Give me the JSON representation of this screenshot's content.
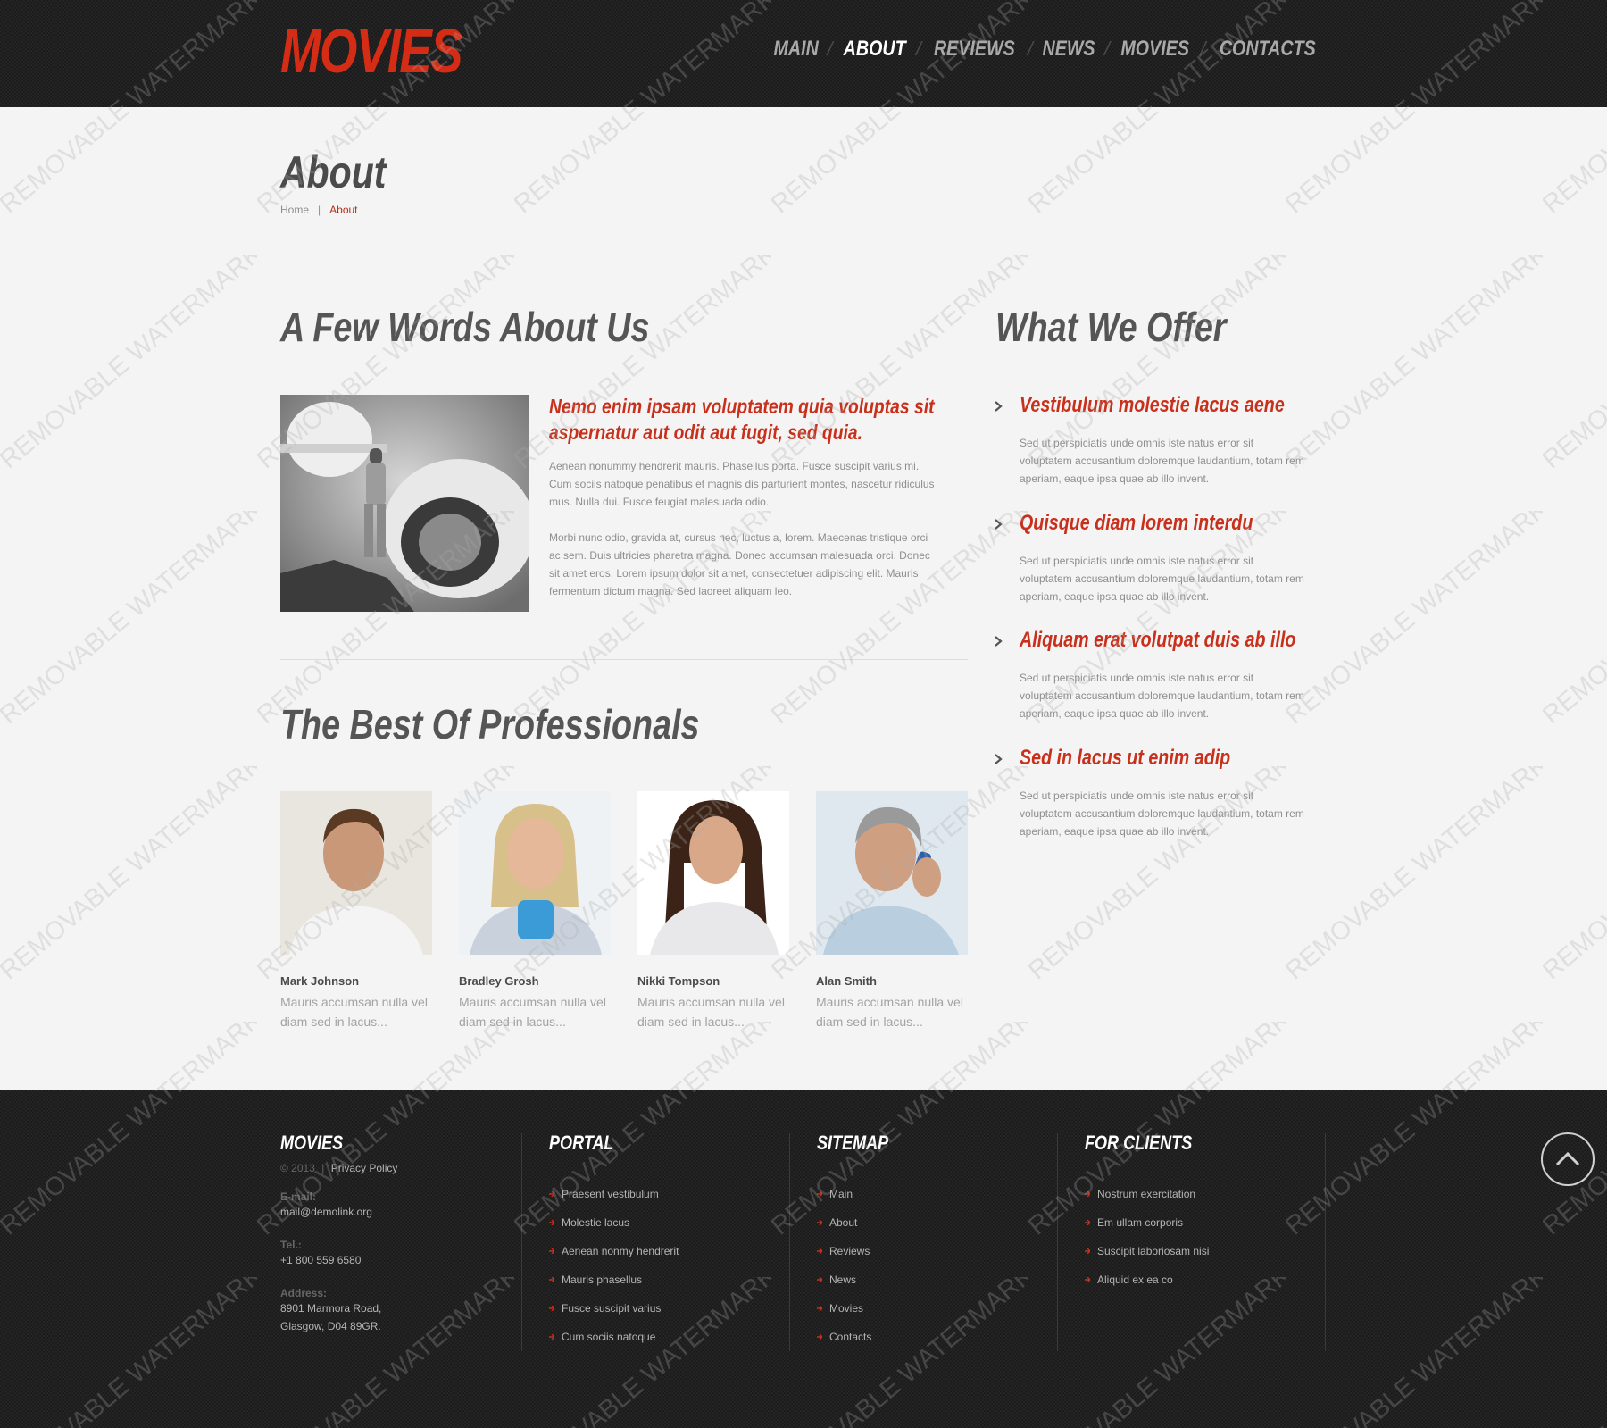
{
  "header": {
    "logo": "MOVIES",
    "nav": [
      {
        "label": "MAIN",
        "active": false
      },
      {
        "label": "ABOUT",
        "active": true
      },
      {
        "label": "REVIEWS",
        "active": false
      },
      {
        "label": "NEWS",
        "active": false
      },
      {
        "label": "MOVIES",
        "active": false
      },
      {
        "label": "CONTACTS",
        "active": false
      }
    ]
  },
  "page": {
    "title": "About",
    "breadcrumb": {
      "home": "Home",
      "separator": "|",
      "current": "About"
    }
  },
  "about": {
    "title": "A Few Words About Us",
    "lead": "Nemo enim ipsam voluptatem quia voluptas sit aspernatur aut odit aut fugit, sed quia.",
    "para1": "Aenean nonummy hendrerit mauris. Phasellus porta. Fusce suscipit varius mi. Cum sociis natoque penatibus et magnis dis parturient montes, nascetur ridiculus mus. Nulla dui. Fusce feugiat malesuada odio.",
    "para2": "Morbi nunc odio, gravida at, cursus nec, luctus a, lorem. Maecenas tristique orci ac sem. Duis ultricies pharetra magna. Donec accumsan malesuada orci. Donec sit amet eros. Lorem ipsum dolor sit amet, consectetuer adipiscing elit. Mauris fermentum dictum magna. Sed laoreet aliquam leo."
  },
  "offer": {
    "title": "What We Offer",
    "items": [
      {
        "title": "Vestibulum molestie lacus aene",
        "text": "Sed ut perspiciatis unde omnis iste natus error sit voluptatem accusantium doloremque laudantium, totam rem aperiam, eaque ipsa quae ab illo invent."
      },
      {
        "title": "Quisque diam lorem interdu",
        "text": "Sed ut perspiciatis unde omnis iste natus error sit voluptatem accusantium doloremque laudantium, totam rem aperiam, eaque ipsa quae ab illo invent."
      },
      {
        "title": "Aliquam erat volutpat duis ab illo",
        "text": "Sed ut perspiciatis unde omnis iste natus error sit voluptatem accusantium doloremque laudantium, totam rem aperiam, eaque ipsa quae ab illo invent."
      },
      {
        "title": "Sed in lacus ut enim adip",
        "text": "Sed ut perspiciatis unde omnis iste natus error sit voluptatem accusantium doloremque laudantium, totam rem aperiam, eaque ipsa quae ab illo invent."
      }
    ]
  },
  "team": {
    "title": "The Best Of Professionals",
    "members": [
      {
        "name": "Mark Johnson",
        "desc": "Mauris accumsan nulla vel diam sed in lacus..."
      },
      {
        "name": "Bradley Grosh",
        "desc": "Mauris accumsan nulla vel diam sed in lacus..."
      },
      {
        "name": "Nikki Tompson",
        "desc": "Mauris accumsan nulla vel diam sed in lacus..."
      },
      {
        "name": "Alan Smith",
        "desc": "Mauris accumsan nulla vel diam sed in lacus..."
      }
    ]
  },
  "footer": {
    "brand": {
      "title": "MOVIES",
      "copyright": "© 2013",
      "separator": "|",
      "privacy": "Privacy Policy",
      "email_label": "E-mail:",
      "email": "mail@demolink.org",
      "tel_label": "Tel.:",
      "tel": "+1 800 559 6580",
      "address_label": "Address:",
      "address_line1": "8901 Marmora Road,",
      "address_line2": "Glasgow, D04 89GR."
    },
    "portal": {
      "title": "PORTAL",
      "links": [
        "Praesent vestibulum",
        "Molestie lacus",
        "Aenean nonmy hendrerit",
        "Mauris phasellus",
        "Fusce suscipit varius",
        "Cum sociis natoque"
      ]
    },
    "sitemap": {
      "title": "SITEMAP",
      "links": [
        "Main",
        "About",
        "Reviews",
        "News",
        "Movies",
        "Contacts"
      ]
    },
    "clients": {
      "title": "FOR CLIENTS",
      "links": [
        "Nostrum exercitation",
        "Em ullam corporis",
        "Suscipit laboriosam nisi",
        "Aliquid ex ea co"
      ]
    }
  },
  "watermark": "REMOVABLE WATERMARK",
  "colors": {
    "accent": "#c8301b",
    "logo": "#d52c15",
    "dark": "#1c1c1c",
    "page_bg": "#f4f4f4"
  }
}
